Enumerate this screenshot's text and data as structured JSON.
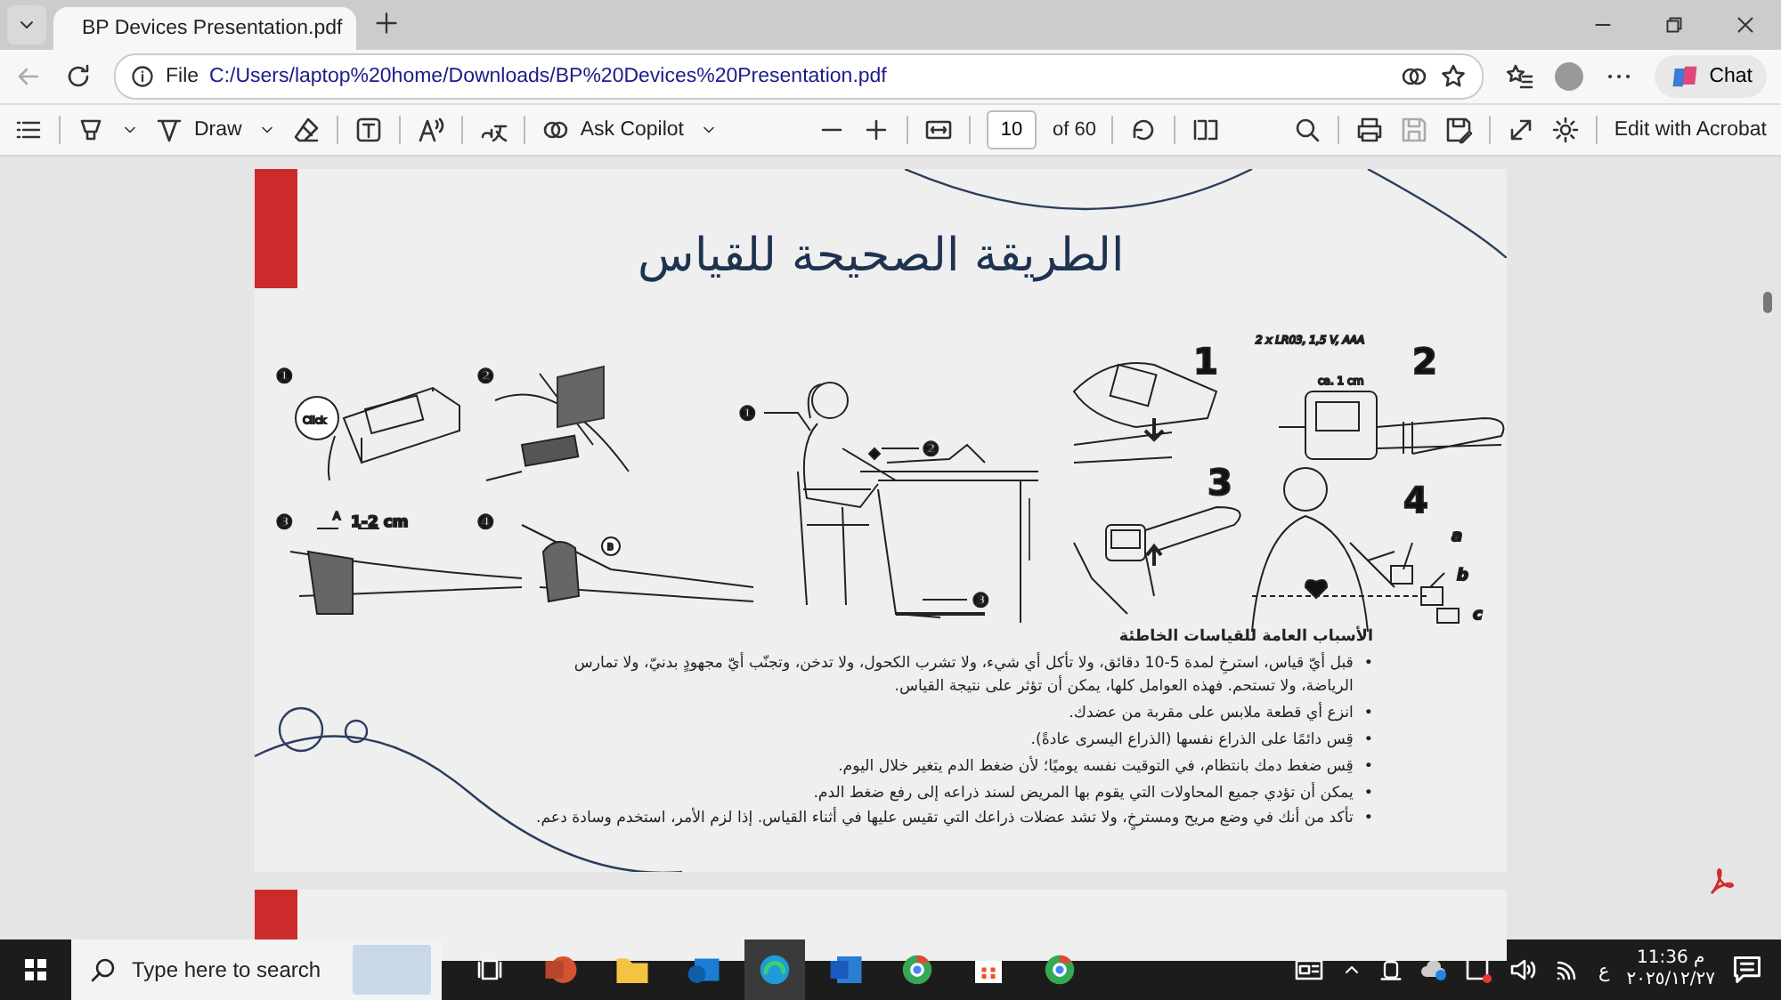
{
  "browser": {
    "tab": {
      "title": "BP Devices Presentation.pdf",
      "selected": true
    },
    "address": {
      "scheme": "File",
      "url": "C:/Users/laptop%20home/Downloads/BP%20Devices%20Presentation.pdf"
    },
    "chat_label": "Chat"
  },
  "pdf_toolbar": {
    "draw_label": "Draw",
    "copilot_label": "Ask Copilot",
    "page_number": "10",
    "page_count": "of 60",
    "acrobat_label": "Edit with Acrobat"
  },
  "slide": {
    "title": "الطريقة الصحيحة للقياس",
    "upper_arm": {
      "marker_1": "❶",
      "marker_2": "❷",
      "marker_3": "❸",
      "marker_4": "❹",
      "click_callout": "Click",
      "point_a": "A",
      "distance": "1-2 cm",
      "point_b": "B"
    },
    "seated": {
      "marker_1": "❶",
      "marker_2": "❷",
      "marker_3": "❸"
    },
    "wrist": {
      "step_1": "1",
      "step_2": "2",
      "step_3": "3",
      "step_4": "4",
      "battery_spec": "2 x LR03, 1,5 V, AAA",
      "distance": "ca. 1 cm",
      "position_a": "a",
      "position_b": "b",
      "position_c": "c"
    },
    "bullet": "•",
    "causes_heading": "الأسباب العامة للقياسات الخاطئة",
    "causes": [
      "قبل أيّ قياس، استرخِ لمدة 5-10 دقائق، ولا تأكل أي شيء، ولا تشرب الكحول، ولا تدخن، وتجنّب أيّ مجهودٍ بدنيّ، ولا تمارس الرياضة، ولا تستحم. فهذه العوامل كلها، يمكن أن تؤثر على نتيجة القياس.",
      "انزع أي قطعة ملابس على مقربة من عضدك.",
      "قِس دائمًا على الذراع نفسها (الذراع اليسرى عادةً).",
      "قِس ضغط دمك بانتظام، في التوقيت نفسه يوميًا؛ لأن ضغط الدم يتغير خلال اليوم.",
      "يمكن أن تؤدي جميع المحاولات التي يقوم بها المريض لسند ذراعه إلى رفع ضغط الدم.",
      "تأكد من أنك في وضع مريح ومسترخٍ، ولا تشد عضلات ذراعك التي تقيس عليها في أثناء القياس. إذا لزم الأمر، استخدم وسادة دعم."
    ]
  },
  "taskbar": {
    "search_placeholder": "Type here to search",
    "language": "ع",
    "time": "11:36 م",
    "date": "٢٠٢٥/١٢/٢٧"
  }
}
